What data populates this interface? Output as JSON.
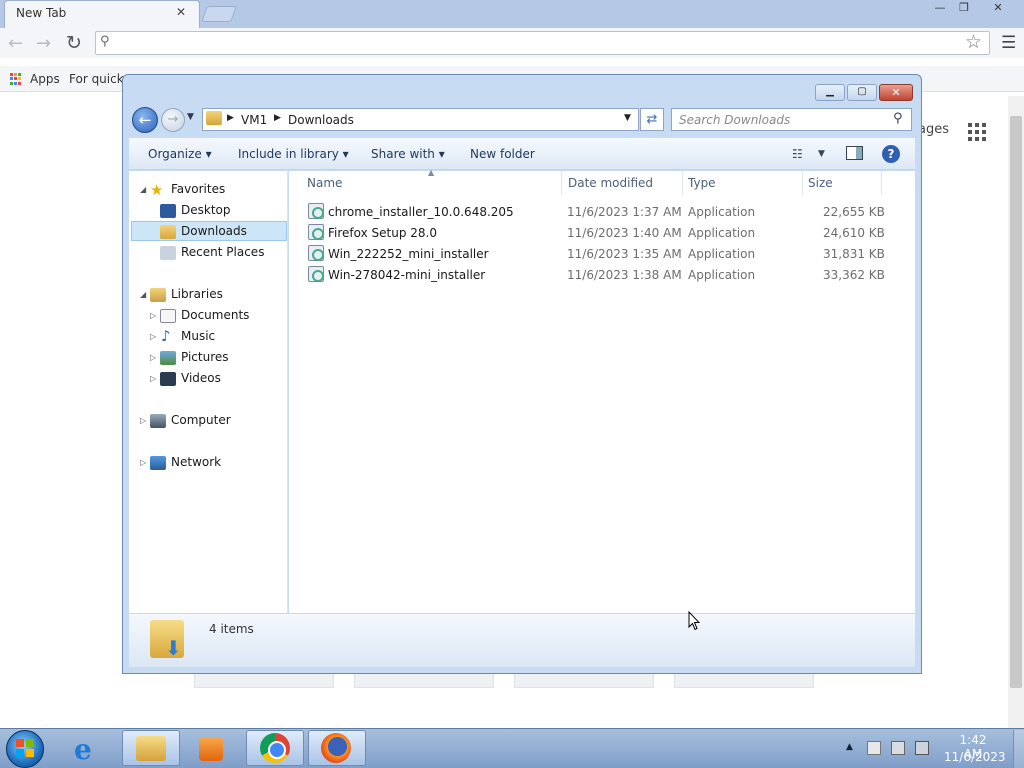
{
  "browser": {
    "tab_title": "New Tab",
    "tab_close": "✕",
    "window_controls": {
      "minimize": "—",
      "restore": "❐",
      "close": "✕"
    },
    "bookmarks": {
      "apps": "Apps",
      "quick": "For quick"
    },
    "ntp": {
      "pages_text": "ages"
    }
  },
  "explorer": {
    "title_controls": {
      "minimize": "▁",
      "maximize": "▢",
      "close": "✕"
    },
    "breadcrumb": [
      "VM1",
      "Downloads"
    ],
    "search_placeholder": "Search Downloads",
    "commands": {
      "organize": "Organize ▾",
      "include": "Include in library ▾",
      "share": "Share with ▾",
      "new_folder": "New folder"
    },
    "nav": {
      "favorites": "Favorites",
      "desktop": "Desktop",
      "downloads": "Downloads",
      "recent": "Recent Places",
      "libraries": "Libraries",
      "documents": "Documents",
      "music": "Music",
      "pictures": "Pictures",
      "videos": "Videos",
      "computer": "Computer",
      "network": "Network"
    },
    "columns": {
      "name": "Name",
      "date": "Date modified",
      "type": "Type",
      "size": "Size"
    },
    "files": [
      {
        "name": "chrome_installer_10.0.648.205",
        "date": "11/6/2023 1:37 AM",
        "type": "Application",
        "size": "22,655 KB"
      },
      {
        "name": "Firefox Setup 28.0",
        "date": "11/6/2023 1:40 AM",
        "type": "Application",
        "size": "24,610 KB"
      },
      {
        "name": "Win_222252_mini_installer",
        "date": "11/6/2023 1:35 AM",
        "type": "Application",
        "size": "31,831 KB"
      },
      {
        "name": "Win-278042-mini_installer",
        "date": "11/6/2023 1:38 AM",
        "type": "Application",
        "size": "33,362 KB"
      }
    ],
    "status": "4 items"
  },
  "taskbar": {
    "time": "1:42 AM",
    "date": "11/6/2023"
  }
}
